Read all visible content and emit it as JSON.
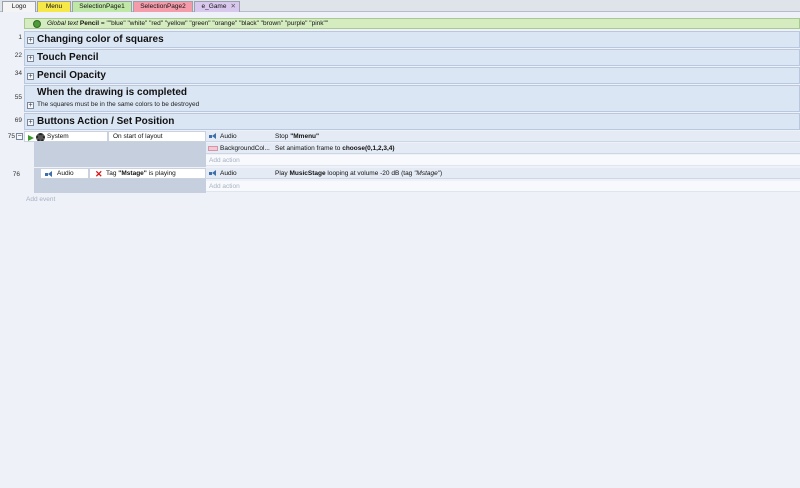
{
  "tabs": [
    {
      "label": "Logo",
      "color": "#f4f4f4"
    },
    {
      "label": "Menu",
      "color": "#f7e84a"
    },
    {
      "label": "SelectionPage1",
      "color": "#bfe7a6"
    },
    {
      "label": "SelectionPage2",
      "color": "#f59cab"
    },
    {
      "label": "e_Game",
      "color": "#d9c8ee",
      "close": "✕"
    }
  ],
  "global_var": {
    "kind": "Global text",
    "name": "Pencil",
    "eq": "=",
    "value": "\"\"blue\" \"white\" \"red\" \"yellow\" \"green\" \"orange\" \"black\" \"brown\" \"purple\" \"pink\"\""
  },
  "groups": [
    {
      "num": "1",
      "title": "Changing color of squares",
      "toggle": "+"
    },
    {
      "num": "22",
      "title": "Touch Pencil",
      "toggle": "+"
    },
    {
      "num": "34",
      "title": "Pencil Opacity",
      "toggle": "+"
    },
    {
      "num": "55",
      "title": "When the drawing is completed",
      "desc": "The squares must be in the same colors to be destroyed",
      "toggle": "+"
    },
    {
      "num": "69",
      "title": "Buttons Action / Set Position",
      "toggle": "+"
    }
  ],
  "event75": {
    "num": "75",
    "toggle": "−",
    "cond_object": "System",
    "cond_text": "On start of layout",
    "actions": [
      {
        "object": "Audio",
        "text_prefix": "Stop ",
        "text_bold": "\"Mmenu\""
      },
      {
        "object": "BackgroundCol...",
        "text_prefix": "Set animation frame to ",
        "text_bold": "choose(0,1,2,3,4)"
      }
    ],
    "add_action": "Add action"
  },
  "event76": {
    "num": "76",
    "cond_object": "Audio",
    "cond_prefix": "Tag ",
    "cond_bold": "\"Mstage\"",
    "cond_suffix": " is playing",
    "action_object": "Audio",
    "action_prefix": "Play ",
    "action_bold": "MusicStage",
    "action_middle": " looping at volume -20 dB (tag ",
    "action_italic": "\"Mstage\"",
    "action_suffix": ")",
    "add_action": "Add action"
  },
  "add_event": "Add event"
}
